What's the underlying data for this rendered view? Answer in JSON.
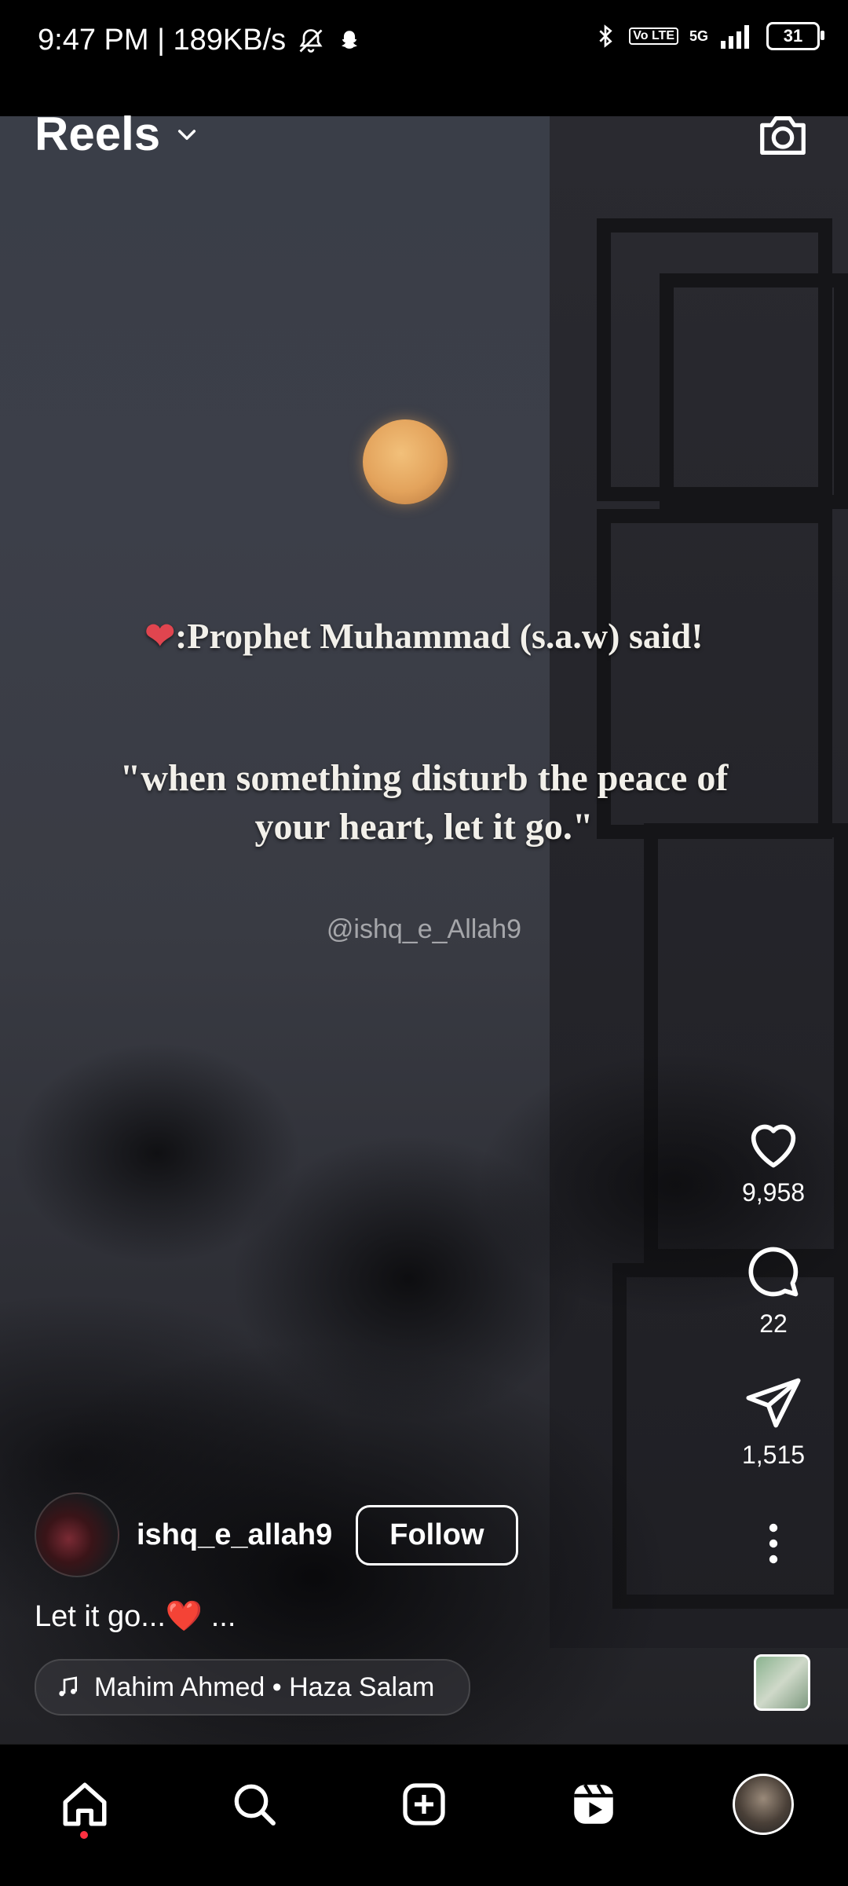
{
  "status_bar": {
    "time_speed": "9:47 PM | 189KB/s",
    "network": "5G",
    "volte": "Vo LTE",
    "battery": "31"
  },
  "header": {
    "title": "Reels",
    "dropdown_icon": "chevron-down-icon",
    "camera_icon": "camera-icon"
  },
  "video": {
    "heading": ":Prophet Muhammad (s.a.w) said!",
    "quote": "\"when something disturb the peace of your heart, let it go.\"",
    "watermark": "@ishq_e_Allah9"
  },
  "actions": {
    "likes": "9,958",
    "comments": "22",
    "shares": "1,515"
  },
  "post": {
    "username": "ishq_e_allah9",
    "follow_label": "Follow",
    "caption": "Let it go...❤️ ...",
    "audio": "Mahim Ahmed • Haza Salam"
  },
  "nav": {
    "items": [
      "home-icon",
      "search-icon",
      "create-icon",
      "reels-icon",
      "profile-avatar"
    ]
  },
  "colors": {
    "accent_dot": "#ff3040",
    "background": "#000000"
  }
}
